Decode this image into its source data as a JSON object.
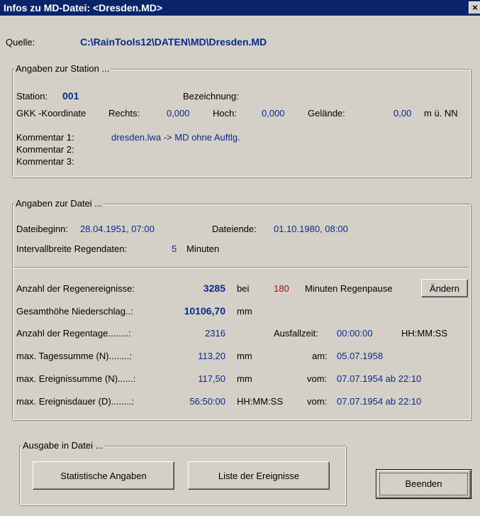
{
  "window": {
    "title": "Infos zu MD-Datei: <Dresden.MD>",
    "close": "×"
  },
  "source": {
    "label": "Quelle:",
    "path": "C:\\RainTools12\\DATEN\\MD\\Dresden.MD"
  },
  "station_group": {
    "legend": "Angaben zur Station ...",
    "station_label": "Station:",
    "station_value": "001",
    "bezeichnung_label": "Bezeichnung:",
    "gkk_label": "GKK -Koordinate",
    "rechts_label": "Rechts:",
    "rechts_value": "0,000",
    "hoch_label": "Hoch:",
    "hoch_value": "0,000",
    "gelaende_label": "Gelände:",
    "gelaende_value": "0,00",
    "gelaende_unit": "m ü. NN",
    "kommentar1_label": "Kommentar 1:",
    "kommentar1_value": "dresden.lwa -> MD ohne Auftlg.",
    "kommentar2_label": "Kommentar 2:",
    "kommentar3_label": "Kommentar 3:"
  },
  "datei_group": {
    "legend": "Angaben zur Datei ...",
    "beginn_label": "Dateibeginn:",
    "beginn_value": "28.04.1951,  07:00",
    "ende_label": "Dateiende:",
    "ende_value": "01.10.1980,  08:00",
    "intervall_label": "Intervallbreite Regendaten:",
    "intervall_value": "5",
    "intervall_unit": "Minuten"
  },
  "stats": {
    "anzahl_label": "Anzahl der Regenereignisse:",
    "anzahl_value": "3285",
    "bei": "bei",
    "pause_value": "180",
    "pause_unit": "Minuten  Regenpause",
    "aendern_button": "Ändern",
    "gesamt_label": "Gesamthöhe Niederschlag..:",
    "gesamt_value": "10106,70",
    "gesamt_unit": "mm",
    "regentage_label": "Anzahl der Regentage........:",
    "regentage_value": "2316",
    "ausfall_label": "Ausfallzeit:",
    "ausfall_value": "00:00:00",
    "ausfall_unit": "HH:MM:SS",
    "tagessumme_label": "max. Tagessumme (N)........:",
    "tagessumme_value": "113,20",
    "tagessumme_unit": "mm",
    "tagessumme_am": "am:",
    "tagessumme_date": "05.07.1958",
    "ereignissumme_label": "max. Ereignissumme (N)......:",
    "ereignissumme_value": "117,50",
    "ereignissumme_unit": "mm",
    "ereignissumme_vom": "vom:",
    "ereignissumme_date": "07.07.1954 ab 22:10",
    "dauer_label": "max. Ereignisdauer (D)........:",
    "dauer_value": "56:50:00",
    "dauer_unit": "HH:MM:SS",
    "dauer_vom": "vom:",
    "dauer_date": "07.07.1954 ab 22:10"
  },
  "ausgabe_group": {
    "legend": "Ausgabe in Datei ...",
    "statistik_button": "Statistische Angaben",
    "liste_button": "Liste der Ereignisse"
  },
  "beenden_button": "Beenden"
}
